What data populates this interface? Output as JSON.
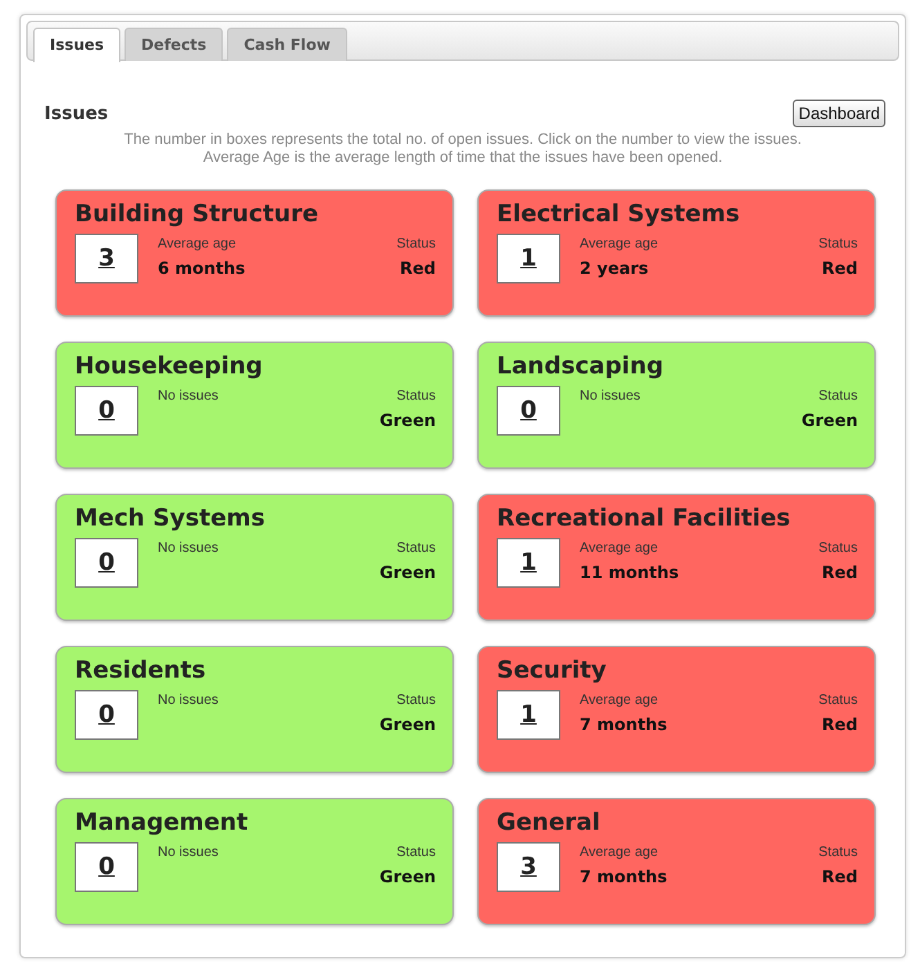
{
  "tabs": [
    {
      "label": "Issues",
      "selected": true
    },
    {
      "label": "Defects",
      "selected": false
    },
    {
      "label": "Cash Flow",
      "selected": false
    }
  ],
  "heading": "Issues",
  "dashboard_button": "Dashboard",
  "notes": [
    "The number in boxes represents the total no. of open issues. Click on the number to view the issues.",
    "Average Age is the average length of time that the issues have been opened."
  ],
  "cards": [
    {
      "title": "Building Structure",
      "count": "3",
      "age_label": "Average age",
      "age": "6 months",
      "status_label": "Status",
      "status": "Red",
      "color": "#ff6660"
    },
    {
      "title": "Electrical Systems",
      "count": "1",
      "age_label": "Average age",
      "age": "2 years",
      "status_label": "Status",
      "status": "Red",
      "color": "#ff6660"
    },
    {
      "title": "Housekeeping",
      "count": "0",
      "age_label": "No issues",
      "status_label": "Status",
      "status": "Green",
      "color": "#a6f56e"
    },
    {
      "title": "Landscaping",
      "count": "0",
      "age_label": "No issues",
      "status_label": "Status",
      "status": "Green",
      "color": "#a6f56e"
    },
    {
      "title": "Mech Systems",
      "count": "0",
      "age_label": "No issues",
      "status_label": "Status",
      "status": "Green",
      "color": "#a6f56e"
    },
    {
      "title": "Recreational Facilities",
      "count": "1",
      "age_label": "Average age",
      "age": "11 months",
      "status_label": "Status",
      "status": "Red",
      "color": "#ff6660"
    },
    {
      "title": "Residents",
      "count": "0",
      "age_label": "No issues",
      "status_label": "Status",
      "status": "Green",
      "color": "#a6f56e"
    },
    {
      "title": "Security",
      "count": "1",
      "age_label": "Average age",
      "age": "7 months",
      "status_label": "Status",
      "status": "Red",
      "color": "#ff6660"
    },
    {
      "title": "Management",
      "count": "0",
      "age_label": "No issues",
      "status_label": "Status",
      "status": "Green",
      "color": "#a6f56e"
    },
    {
      "title": "General",
      "count": "3",
      "age_label": "Average age",
      "age": "7 months",
      "status_label": "Status",
      "status": "Red",
      "color": "#ff6660"
    }
  ]
}
